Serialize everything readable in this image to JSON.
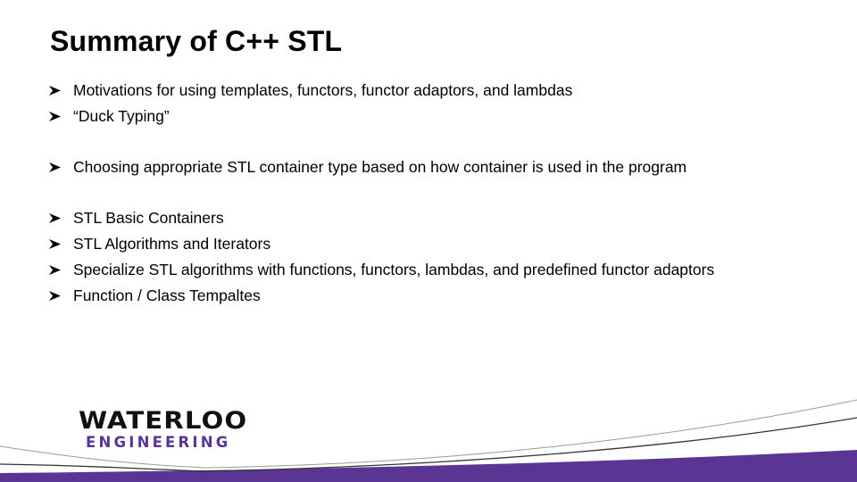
{
  "slide": {
    "title": "Summary of C++ STL",
    "bullets": [
      {
        "icon": "arrowhead-bullet-icon",
        "text": "Motivations for using templates, functors, functor adaptors, and lambdas"
      },
      {
        "icon": "arrowhead-bullet-icon",
        "text": "“Duck Typing”"
      },
      {
        "icon": "arrowhead-bullet-icon",
        "text": "Choosing appropriate STL container type based on how container is used in the program"
      },
      {
        "icon": "arrowhead-bullet-icon",
        "text": "STL Basic Containers"
      },
      {
        "icon": "arrowhead-bullet-icon",
        "text": "STL Algorithms and Iterators"
      },
      {
        "icon": "arrowhead-bullet-icon",
        "text": "Specialize STL algorithms with functions, functors, lambdas, and predefined functor adaptors"
      },
      {
        "icon": "arrowhead-bullet-icon",
        "text": "Function / Class Tempaltes"
      }
    ]
  },
  "logo": {
    "line1": "WATERLOO",
    "line2": "ENGINEERING"
  },
  "colors": {
    "brand_purple": "#5b3593",
    "text": "#000000"
  }
}
